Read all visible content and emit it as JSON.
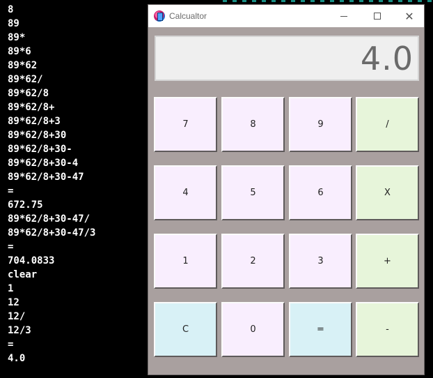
{
  "console": {
    "lines": [
      "8",
      "89",
      "89*",
      "89*6",
      "89*62",
      "89*62/",
      "89*62/8",
      "89*62/8+",
      "89*62/8+3",
      "89*62/8+30",
      "89*62/8+30-",
      "89*62/8+30-4",
      "89*62/8+30-47",
      "=",
      "672.75",
      "89*62/8+30-47/",
      "89*62/8+30-47/3",
      "=",
      "704.0833",
      "clear",
      "1",
      "12",
      "12/",
      "12/3",
      "=",
      "4.0"
    ]
  },
  "window": {
    "title": "Calcualtor",
    "icon": "calculator-app-icon",
    "controls": {
      "minimize": "minimize-icon",
      "maximize": "maximize-icon",
      "close": "close-icon"
    }
  },
  "display": {
    "value": "4.0"
  },
  "keypad": {
    "rows": [
      [
        {
          "label": "7",
          "kind": "num"
        },
        {
          "label": "8",
          "kind": "num"
        },
        {
          "label": "9",
          "kind": "num"
        },
        {
          "label": "/",
          "kind": "op"
        }
      ],
      [
        {
          "label": "4",
          "kind": "num"
        },
        {
          "label": "5",
          "kind": "num"
        },
        {
          "label": "6",
          "kind": "num"
        },
        {
          "label": "X",
          "kind": "op"
        }
      ],
      [
        {
          "label": "1",
          "kind": "num"
        },
        {
          "label": "2",
          "kind": "num"
        },
        {
          "label": "3",
          "kind": "num"
        },
        {
          "label": "+",
          "kind": "op"
        }
      ],
      [
        {
          "label": "C",
          "kind": "fn"
        },
        {
          "label": "0",
          "kind": "num"
        },
        {
          "label": "=",
          "kind": "fn"
        },
        {
          "label": "-",
          "kind": "op"
        }
      ]
    ]
  },
  "colors": {
    "window_bg": "#a9a09f",
    "number_key": "#f9eefe",
    "operator_key": "#e7f5da",
    "function_key": "#d8f1f6",
    "display_bg": "#efefef",
    "console_bg": "#000000",
    "console_text": "#ffffff"
  }
}
